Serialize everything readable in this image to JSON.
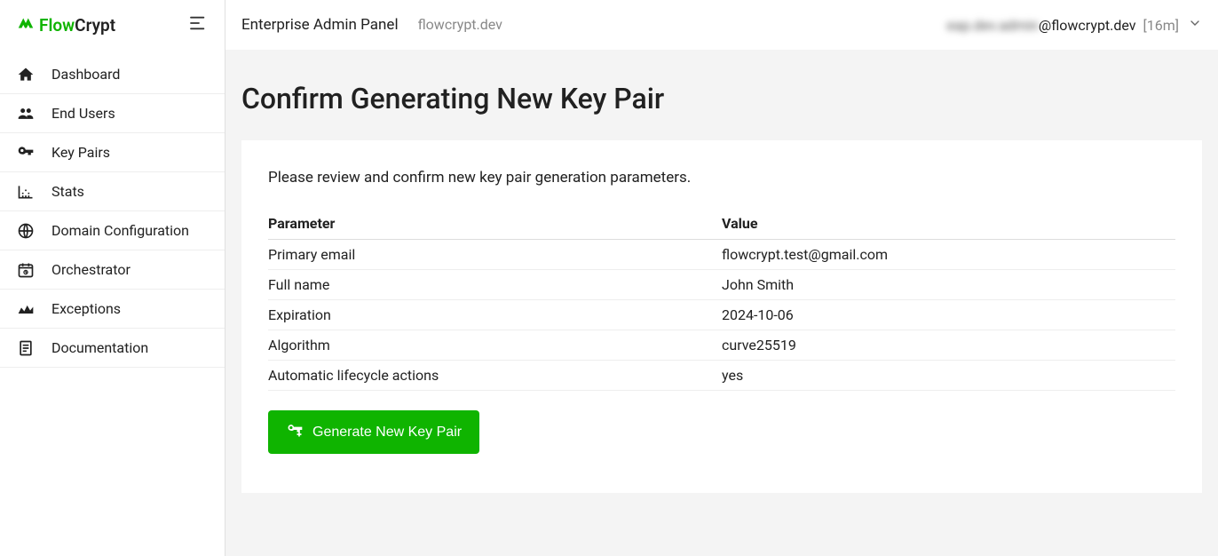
{
  "brand": {
    "flow": "Flow",
    "crypt": "Crypt"
  },
  "sidebar": {
    "items": [
      {
        "label": "Dashboard",
        "name": "sidebar-item-dashboard",
        "icon": "home-icon"
      },
      {
        "label": "End Users",
        "name": "sidebar-item-end-users",
        "icon": "users-icon"
      },
      {
        "label": "Key Pairs",
        "name": "sidebar-item-key-pairs",
        "icon": "key-icon"
      },
      {
        "label": "Stats",
        "name": "sidebar-item-stats",
        "icon": "stats-icon"
      },
      {
        "label": "Domain Configuration",
        "name": "sidebar-item-domain-configuration",
        "icon": "globe-icon"
      },
      {
        "label": "Orchestrator",
        "name": "sidebar-item-orchestrator",
        "icon": "calendar-icon"
      },
      {
        "label": "Exceptions",
        "name": "sidebar-item-exceptions",
        "icon": "exceptions-icon"
      },
      {
        "label": "Documentation",
        "name": "sidebar-item-documentation",
        "icon": "document-icon"
      }
    ]
  },
  "topbar": {
    "title": "Enterprise Admin Panel",
    "domain": "flowcrypt.dev",
    "user_obscured": "eap.dev.admin",
    "user_domain": "@flowcrypt.dev",
    "user_suffix": "[16m]"
  },
  "page": {
    "title": "Confirm Generating New Key Pair",
    "intro": "Please review and confirm new key pair generation parameters."
  },
  "table": {
    "headers": {
      "param": "Parameter",
      "value": "Value"
    },
    "rows": [
      {
        "param": "Primary email",
        "value": "flowcrypt.test@gmail.com"
      },
      {
        "param": "Full name",
        "value": "John Smith"
      },
      {
        "param": "Expiration",
        "value": "2024-10-06"
      },
      {
        "param": "Algorithm",
        "value": "curve25519"
      },
      {
        "param": "Automatic lifecycle actions",
        "value": "yes"
      }
    ]
  },
  "button": {
    "label": "Generate New Key Pair"
  }
}
